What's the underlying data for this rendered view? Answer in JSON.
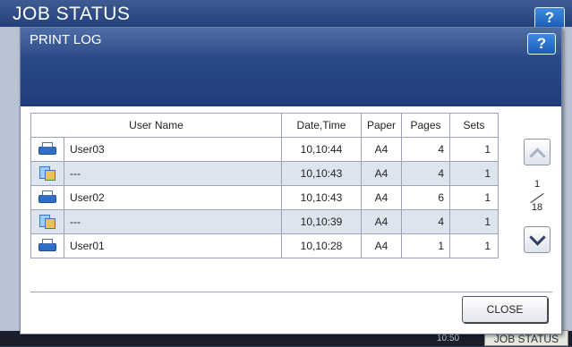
{
  "background": {
    "title": "JOB STATUS",
    "help_label": "?",
    "clock": "10:50",
    "job_status_label": "JOB STATUS"
  },
  "dialog": {
    "title": "PRINT LOG",
    "help_label": "?",
    "columns": [
      "User Name",
      "Date,Time",
      "Paper",
      "Pages",
      "Sets"
    ],
    "rows": [
      {
        "icon": "printer-icon",
        "user": "User03",
        "datetime": "10,10:44",
        "paper": "A4",
        "pages": "4",
        "sets": "1"
      },
      {
        "icon": "copy-icon",
        "user": "---",
        "datetime": "10,10:43",
        "paper": "A4",
        "pages": "4",
        "sets": "1"
      },
      {
        "icon": "printer-icon",
        "user": "User02",
        "datetime": "10,10:43",
        "paper": "A4",
        "pages": "6",
        "sets": "1"
      },
      {
        "icon": "copy-icon",
        "user": "---",
        "datetime": "10,10:39",
        "paper": "A4",
        "pages": "4",
        "sets": "1"
      },
      {
        "icon": "printer-icon",
        "user": "User01",
        "datetime": "10,10:28",
        "paper": "A4",
        "pages": "1",
        "sets": "1"
      }
    ],
    "pagination": {
      "current": "1",
      "total": "18"
    },
    "close_label": "CLOSE"
  },
  "colors": {
    "header_blue": "#2d4c89",
    "alt_row": "#dde4ee",
    "help_button": "#1c5cb8"
  }
}
